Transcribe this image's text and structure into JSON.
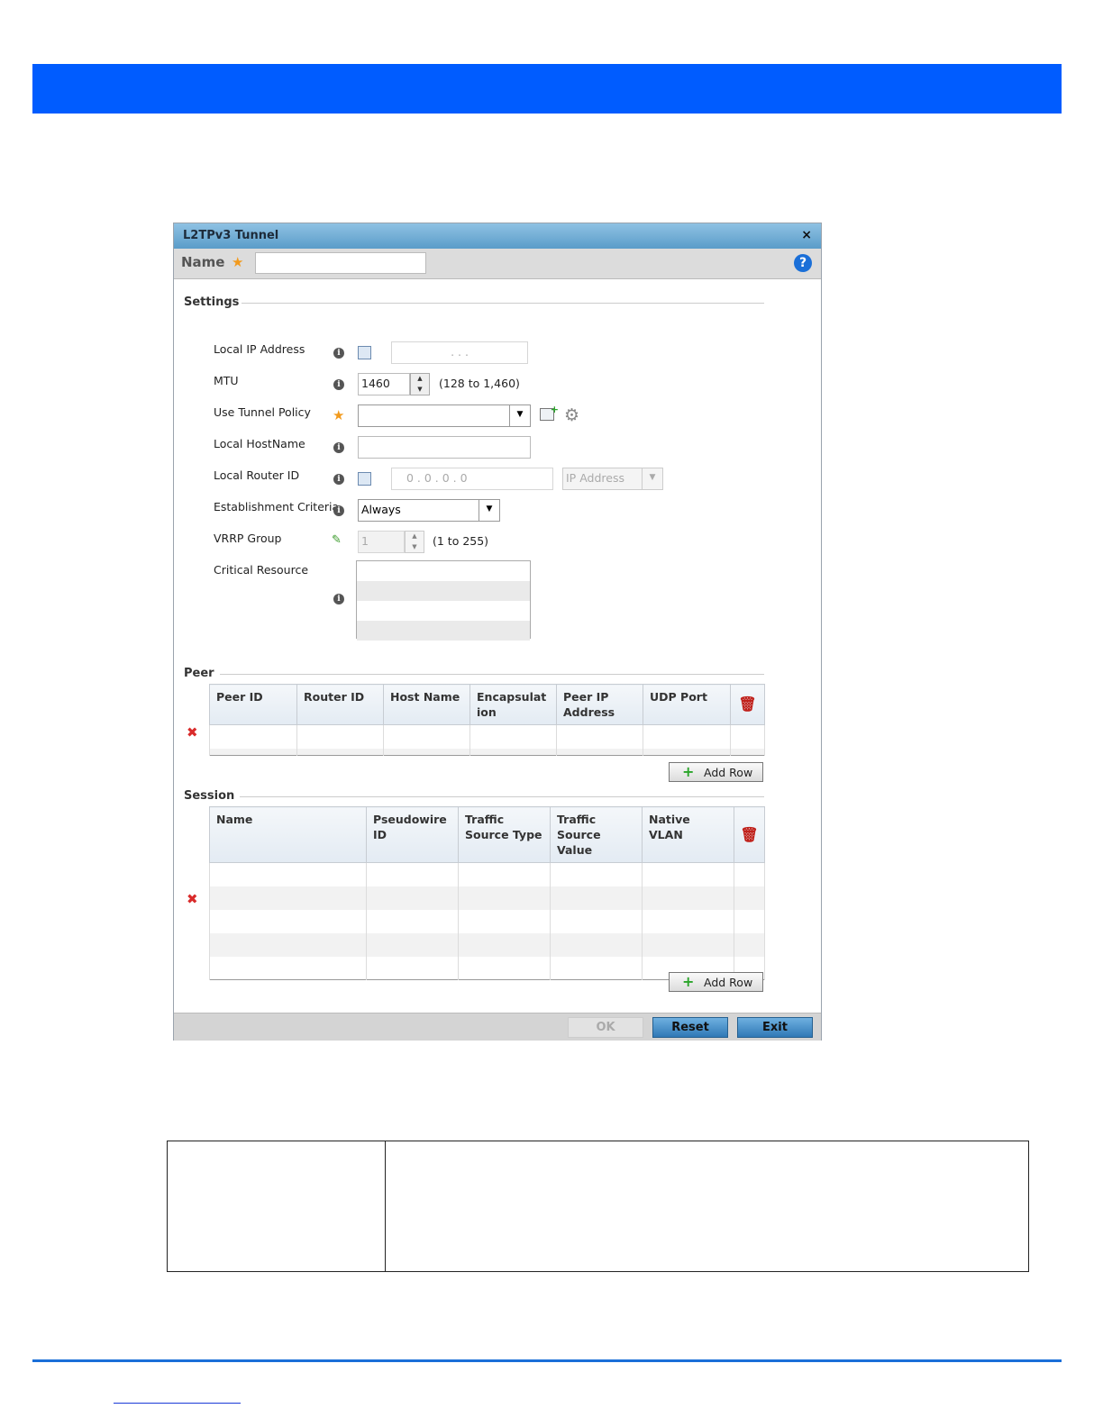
{
  "dialog": {
    "title": "L2TPv3 Tunnel",
    "close": "×",
    "name_label": "Name",
    "name_value": "",
    "help": "?"
  },
  "settings": {
    "section": "Settings",
    "local_ip_label": "Local IP Address",
    "local_ip_value": ".      .      .",
    "mtu_label": "MTU",
    "mtu_value": "1460",
    "mtu_hint": "(128 to 1,460)",
    "tunnel_policy_label": "Use Tunnel Policy",
    "tunnel_policy_value": "",
    "local_hostname_label": "Local HostName",
    "local_hostname_value": "",
    "router_id_label": "Local Router ID",
    "router_id_value": "0  .  0  .  0  .  0",
    "router_id_type": "IP Address",
    "establishment_label": "Establishment Criteria",
    "establishment_value": "Always",
    "vrrp_label": "VRRP Group",
    "vrrp_value": "1",
    "vrrp_hint": "(1 to 255)",
    "critical_label": "Critical Resource"
  },
  "peer": {
    "section": "Peer",
    "columns": [
      "Peer ID",
      "Router ID",
      "Host Name",
      "Encapsulation",
      "Peer IP Address",
      "UDP Port"
    ],
    "add_row": "Add Row"
  },
  "session": {
    "section": "Session",
    "columns": [
      "Name",
      "Pseudowire ID",
      "Traffic Source Type",
      "Traffic Source Value",
      "Native VLAN"
    ],
    "add_row": "Add Row"
  },
  "footer": {
    "ok": "OK",
    "reset": "Reset",
    "exit": "Exit"
  },
  "colors": {
    "header_bar": "#005cff",
    "title_bar": "#5a9cc9",
    "accent_button": "#2f78b6"
  }
}
